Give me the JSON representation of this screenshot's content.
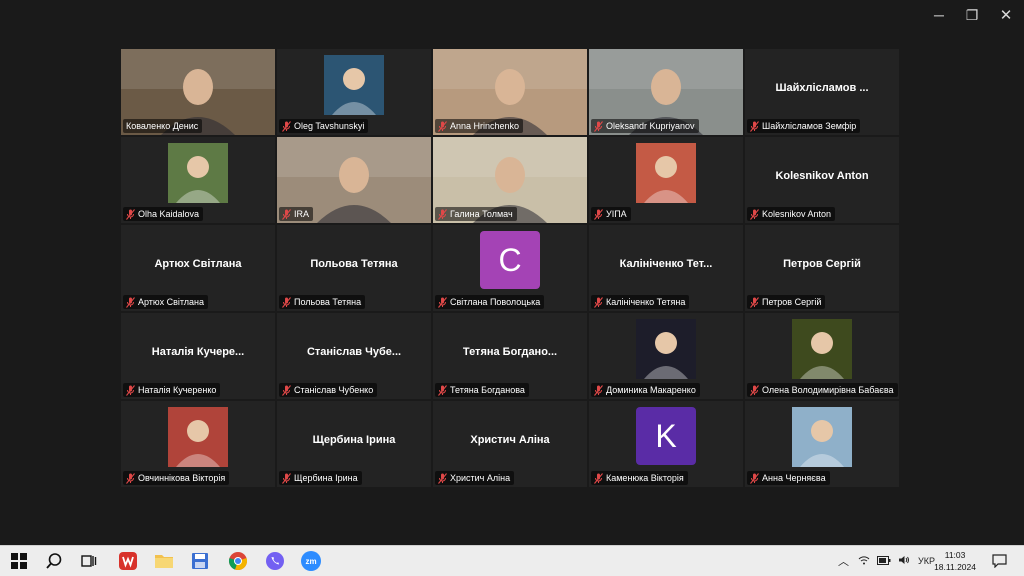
{
  "window": {
    "minimize": "─",
    "maximize": "❐",
    "close": "✕"
  },
  "tiles": [
    {
      "name": "Коваленко Денис",
      "kind": "video",
      "muted": false,
      "active": true,
      "bg": "#6b5a46"
    },
    {
      "name": "Oleg Tavshunskyi",
      "kind": "avatar",
      "muted": true,
      "bg": "#2c5573"
    },
    {
      "name": "Anna Hrinchenko",
      "kind": "video",
      "muted": true,
      "bg": "#b79a7e"
    },
    {
      "name": "Oleksandr Kupriyanov",
      "kind": "video",
      "muted": true,
      "bg": "#8a8f8c"
    },
    {
      "name": "Шайхлісламов Земфір",
      "display": "Шайхлісламов ...",
      "kind": "name",
      "muted": true
    },
    {
      "name": "Olha Kaidalova",
      "kind": "avatar",
      "muted": true,
      "bg": "#5e7a45"
    },
    {
      "name": "IRA",
      "kind": "video",
      "muted": true,
      "bg": "#9c8c7a"
    },
    {
      "name": "Галина Толмач",
      "kind": "video",
      "muted": true,
      "bg": "#c9bfa8"
    },
    {
      "name": "УІПА",
      "kind": "avatar",
      "muted": true,
      "bg": "#c45a45"
    },
    {
      "name": "Kolesnikov Anton",
      "display": "Kolesnikov Anton",
      "kind": "name",
      "muted": true
    },
    {
      "name": "Артюх Світлана",
      "display": "Артюх Світлана",
      "kind": "name",
      "muted": true
    },
    {
      "name": "Польова Тетяна",
      "display": "Польова Тетяна",
      "kind": "name",
      "muted": true
    },
    {
      "name": "Світлана Поволоцька",
      "kind": "letter",
      "letter": "C",
      "color": "#a443b5",
      "muted": true
    },
    {
      "name": "Калініченко Тетяна",
      "display": "Калініченко Тет...",
      "kind": "name",
      "muted": true
    },
    {
      "name": "Петров Сергій",
      "display": "Петров Сергій",
      "kind": "name",
      "muted": true
    },
    {
      "name": "Наталія Кучеренко",
      "display": "Наталія Кучере...",
      "kind": "name",
      "muted": true
    },
    {
      "name": "Станіслав Чубенко",
      "display": "Станіслав Чубе...",
      "kind": "name",
      "muted": true
    },
    {
      "name": "Тетяна Богданова",
      "display": "Тетяна Богдано...",
      "kind": "name",
      "muted": true
    },
    {
      "name": "Доминика Макаренко",
      "kind": "avatar",
      "muted": true,
      "bg": "#1d1d2a"
    },
    {
      "name": "Олена Володимирівна Бабаєва",
      "kind": "avatar",
      "muted": true,
      "bg": "#3e4a1e"
    },
    {
      "name": "Овчиннікова Вікторія",
      "kind": "avatar",
      "muted": true,
      "bg": "#b0443a"
    },
    {
      "name": "Щербина Ірина",
      "display": "Щербина Ірина",
      "kind": "name",
      "muted": true
    },
    {
      "name": "Христич Аліна",
      "display": "Христич Аліна",
      "kind": "name",
      "muted": true
    },
    {
      "name": "Каменюка Вікторія",
      "kind": "letter",
      "letter": "K",
      "color": "#5a2ca6",
      "muted": true
    },
    {
      "name": "Анна Черняєва",
      "kind": "avatar",
      "muted": true,
      "bg": "#8fb0c9"
    }
  ],
  "taskbar": {
    "zoom_label": "zm",
    "lang": "УКР",
    "time": "11:03",
    "date": "18.11.2024"
  }
}
